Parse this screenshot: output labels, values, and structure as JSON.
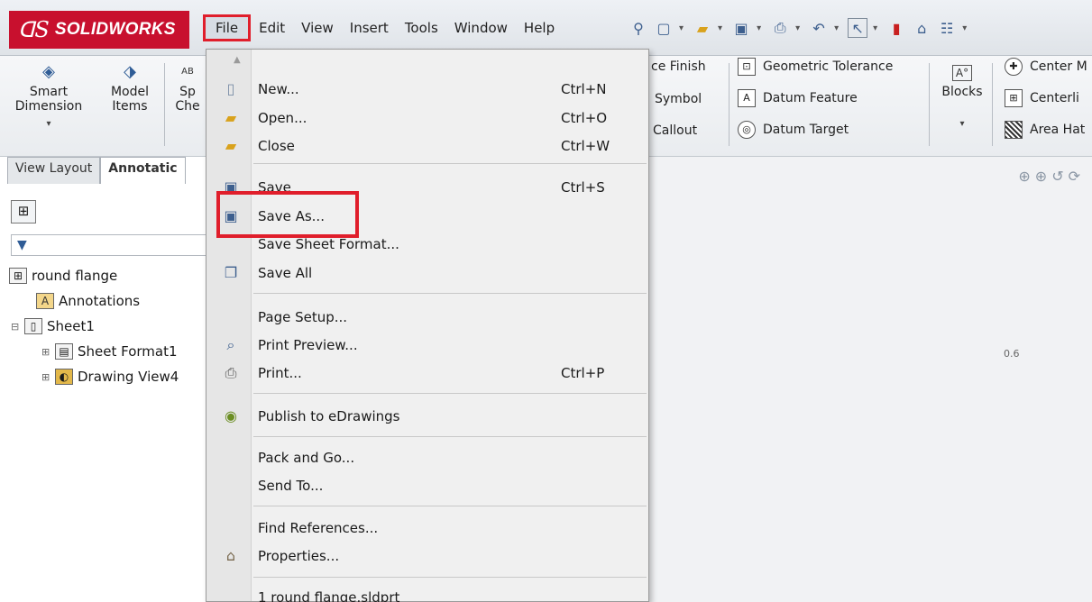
{
  "app": {
    "logo_prefix": "ꓷS",
    "logo_text": "SOLIDWORKS"
  },
  "menubar": {
    "items": [
      "File",
      "Edit",
      "View",
      "Insert",
      "Tools",
      "Window",
      "Help"
    ]
  },
  "ribbon": {
    "smart_dimension": "Smart\nDimension",
    "model_items": "Model\nItems",
    "spell_check": "Sp\nChe",
    "ab": "AB",
    "surface_finish": "ce Finish",
    "symbol": "Symbol",
    "callout": "Callout",
    "geometric_tolerance": "Geometric Tolerance",
    "datum_feature": "Datum Feature",
    "datum_target": "Datum Target",
    "blocks": "Blocks",
    "center_mark": "Center M",
    "centerline": "Centerli",
    "area_hatch": "Area Hat"
  },
  "left_panel": {
    "tabs": [
      "View Layout",
      "Annotatic"
    ],
    "tree": [
      {
        "label": "round flange",
        "icon": "drawing-icon"
      },
      {
        "label": "Annotations",
        "icon": "annotation-icon"
      },
      {
        "label": "Sheet1",
        "icon": "sheet-icon"
      },
      {
        "label": "Sheet Format1",
        "icon": "sheet-format-icon"
      },
      {
        "label": "Drawing View4",
        "icon": "drawing-view-icon"
      }
    ]
  },
  "file_menu": {
    "items": [
      {
        "label": "New...",
        "shortcut": "Ctrl+N"
      },
      {
        "label": "Open...",
        "shortcut": "Ctrl+O"
      },
      {
        "label": "Close",
        "shortcut": "Ctrl+W"
      },
      {
        "label": "Save",
        "shortcut": "Ctrl+S"
      },
      {
        "label": "Save As...",
        "shortcut": ""
      },
      {
        "label": "Save Sheet Format...",
        "shortcut": ""
      },
      {
        "label": "Save All",
        "shortcut": ""
      },
      {
        "label": "Page Setup...",
        "shortcut": ""
      },
      {
        "label": "Print Preview...",
        "shortcut": ""
      },
      {
        "label": "Print...",
        "shortcut": "Ctrl+P"
      },
      {
        "label": "Publish to eDrawings",
        "shortcut": ""
      },
      {
        "label": "Pack and Go...",
        "shortcut": ""
      },
      {
        "label": "Send To...",
        "shortcut": ""
      },
      {
        "label": "Find References...",
        "shortcut": ""
      },
      {
        "label": "Properties...",
        "shortcut": ""
      },
      {
        "label": "1 round flange.sldprt",
        "shortcut": ""
      }
    ]
  },
  "canvas": {
    "note": "0.6"
  },
  "colors": {
    "highlight": "#e01e2b",
    "logo_bg": "#c8102e"
  }
}
